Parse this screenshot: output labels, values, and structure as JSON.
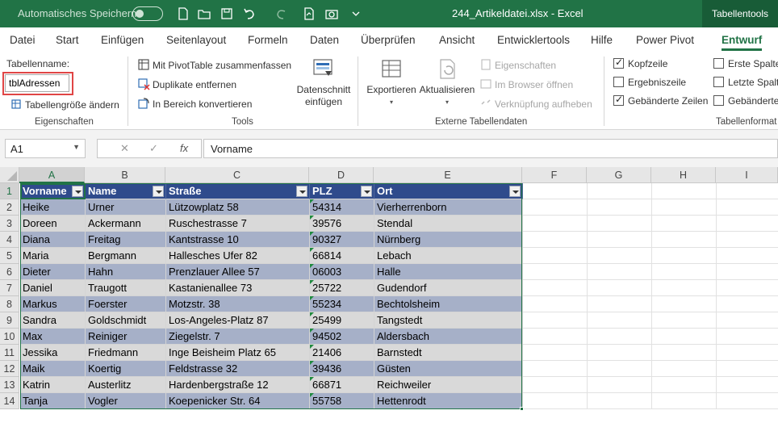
{
  "titlebar": {
    "autosave_label": "Automatisches Speichern",
    "doc_title": "244_Artikeldatei.xlsx  -  Excel",
    "context_tab": "Tabellentools",
    "accent": "#217346"
  },
  "tabs": [
    "Datei",
    "Start",
    "Einfügen",
    "Seitenlayout",
    "Formeln",
    "Daten",
    "Überprüfen",
    "Ansicht",
    "Entwicklertools",
    "Hilfe",
    "Power Pivot",
    "Entwurf"
  ],
  "ribbon": {
    "props": {
      "tablename_label": "Tabellenname:",
      "tablename_value": "tblAdressen",
      "resize_label": "Tabellengröße ändern",
      "group_label": "Eigenschaften"
    },
    "tools": {
      "pivot_label": "Mit PivotTable zusammenfassen",
      "dupes_label": "Duplikate entfernen",
      "convert_label": "In Bereich konvertieren",
      "slicer_label_1": "Datenschnitt",
      "slicer_label_2": "einfügen",
      "group_label": "Tools"
    },
    "external": {
      "export_label": "Exportieren",
      "refresh_label": "Aktualisieren",
      "props_label": "Eigenschaften",
      "browser_label": "Im Browser öffnen",
      "unlink_label": "Verknüpfung aufheben",
      "group_label": "Externe Tabellendaten"
    },
    "styleopts": {
      "header_row": "Kopfzeile",
      "total_row": "Ergebniszeile",
      "banded_rows": "Gebänderte Zeilen",
      "first_col": "Erste Spalte",
      "last_col": "Letzte Spalte",
      "banded_cols": "Gebänderte",
      "group_label": "Tabellenformat"
    }
  },
  "formulabar": {
    "namebox": "A1",
    "formula": "Vorname",
    "fx": "fx"
  },
  "grid": {
    "columns": [
      "A",
      "B",
      "C",
      "D",
      "E",
      "F",
      "G",
      "H",
      "I"
    ],
    "rows": [
      "1",
      "2",
      "3",
      "4",
      "5",
      "6",
      "7",
      "8",
      "9",
      "10",
      "11",
      "12",
      "13",
      "14"
    ],
    "table": {
      "headers": [
        "Vorname",
        "Name",
        "Straße",
        "PLZ",
        "Ort"
      ],
      "data": [
        [
          "Heike",
          "Urner",
          "Lützowplatz 58",
          "54314",
          "Vierherrenborn"
        ],
        [
          "Doreen",
          "Ackermann",
          "Ruschestrasse 7",
          "39576",
          "Stendal"
        ],
        [
          "Diana",
          "Freitag",
          "Kantstrasse 10",
          "90327",
          "Nürnberg"
        ],
        [
          "Maria",
          "Bergmann",
          "Hallesches Ufer 82",
          "66814",
          "Lebach"
        ],
        [
          "Dieter",
          "Hahn",
          "Prenzlauer Allee 57",
          "06003",
          "Halle"
        ],
        [
          "Daniel",
          "Traugott",
          "Kastanienallee 73",
          "25722",
          "Gudendorf"
        ],
        [
          "Markus",
          "Foerster",
          "Motzstr. 38",
          "55234",
          "Bechtolsheim"
        ],
        [
          "Sandra",
          "Goldschmidt",
          "Los-Angeles-Platz 87",
          "25499",
          "Tangstedt"
        ],
        [
          "Max",
          "Reiniger",
          "Ziegelstr. 7",
          "94502",
          "Aldersbach"
        ],
        [
          "Jessika",
          "Friedmann",
          "Inge Beisheim Platz 65",
          "21406",
          "Barnstedt"
        ],
        [
          "Maik",
          "Koertig",
          "Feldstrasse 32",
          "39436",
          "Güsten"
        ],
        [
          "Katrin",
          "Austerlitz",
          "Hardenbergstraße 12",
          "66871",
          "Reichweiler"
        ],
        [
          "Tanja",
          "Vogler",
          "Koepenicker Str. 64",
          "55758",
          "Hettenrodt"
        ]
      ]
    }
  }
}
